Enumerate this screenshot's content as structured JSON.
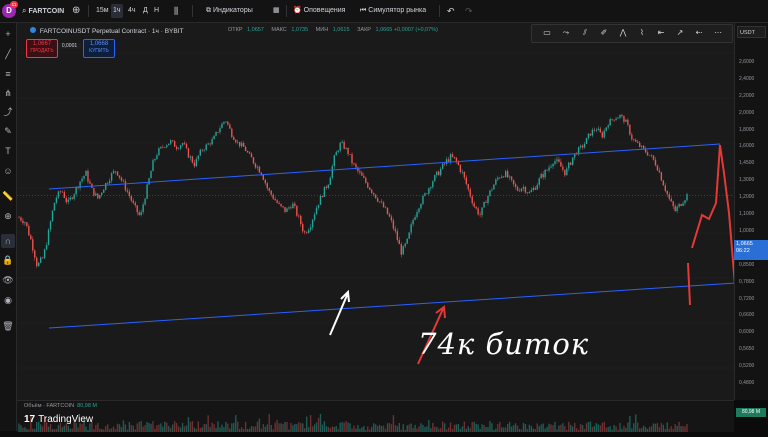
{
  "topbar": {
    "avatar_initial": "D",
    "avatar_badge": "11",
    "symbol": "FARTCOIN",
    "timeframes": [
      {
        "label": "15м",
        "active": false
      },
      {
        "label": "1ч",
        "active": true
      },
      {
        "label": "4ч",
        "active": false
      },
      {
        "label": "Д",
        "active": false
      },
      {
        "label": "Н",
        "active": false
      }
    ],
    "indicators_label": "Индикаторы",
    "alerts_label": "Оповещения",
    "replay_label": "Симулятор рынка"
  },
  "legend": {
    "title": "FARTCOINUSDT Perpetual Contract · 1ч · BYBIT",
    "ohlc": [
      {
        "key": "ОТКР",
        "value": "1,0657"
      },
      {
        "key": "МАКС",
        "value": "1,0735"
      },
      {
        "key": "МИН",
        "value": "1,0615"
      },
      {
        "key": "ЗАКР",
        "value": "1,0665 +0,0007 (+0,07%)"
      }
    ]
  },
  "order_buttons": {
    "sell_price": "1,0667",
    "sell_label": "ПРОДАТЬ",
    "spread": "0,0001",
    "buy_price": "1,0668",
    "buy_label": "КУПИТЬ"
  },
  "currency": "USDT",
  "price_scale": [
    "2,6000",
    "2,4000",
    "2,2000",
    "2,0000",
    "1,8000",
    "1,6000",
    "1,4500",
    "1,3000",
    "1,2000",
    "1,1000",
    "1,0000",
    "0,9200",
    "0,8500",
    "0,7800",
    "0,7200",
    "0,6600",
    "0,6000",
    "0,5650",
    "0,5200",
    "0,4800"
  ],
  "last_price": {
    "price": "1,0665",
    "countdown": "06:22",
    "color": "#2a6fd6"
  },
  "volume": {
    "label": "Объём · FARTCOIN",
    "value": "80,98 M",
    "tag": "80,98 M"
  },
  "branding": {
    "logo": "TradingView"
  },
  "annotation": {
    "text": "74к биток",
    "color": "#ffffff"
  },
  "colors": {
    "up": "#26a69a",
    "down": "#ef5350",
    "channel": "#2962ff",
    "arrow_red": "#e53935"
  },
  "chart_data": {
    "type": "candlestick",
    "symbol": "FARTCOINUSDT",
    "interval": "1h",
    "close_series": [
      0.95,
      0.93,
      0.85,
      0.75,
      0.78,
      0.9,
      1.05,
      1.1,
      1.02,
      1.08,
      1.15,
      1.2,
      1.1,
      1.05,
      1.12,
      1.18,
      1.22,
      1.15,
      1.08,
      1.0,
      0.95,
      1.1,
      1.25,
      1.35,
      1.4,
      1.43,
      1.38,
      1.42,
      1.3,
      1.25,
      1.35,
      1.4,
      1.45,
      1.55,
      1.63,
      1.5,
      1.42,
      1.38,
      1.3,
      1.25,
      1.2,
      1.1,
      1.05,
      1.0,
      0.98,
      1.02,
      0.95,
      0.88,
      0.92,
      1.0,
      1.08,
      1.15,
      1.3,
      1.42,
      1.35,
      1.25,
      1.2,
      1.15,
      1.1,
      1.05,
      1.0,
      0.95,
      0.88,
      0.8,
      0.85,
      0.95,
      1.02,
      1.08,
      1.15,
      1.2,
      1.25,
      1.3,
      1.27,
      1.2,
      1.1,
      1.0,
      0.96,
      1.05,
      1.12,
      1.18,
      1.2,
      1.15,
      1.1,
      1.12,
      1.08,
      1.12,
      1.18,
      1.22,
      1.28,
      1.25,
      1.2,
      1.28,
      1.35,
      1.4,
      1.5,
      1.55,
      1.48,
      1.6,
      1.65,
      1.68,
      1.6,
      1.45,
      1.4,
      1.35,
      1.3,
      1.25,
      1.15,
      1.05,
      0.98,
      1.02,
      1.07
    ],
    "ylim": [
      0.48,
      2.6
    ],
    "ylog": true
  }
}
